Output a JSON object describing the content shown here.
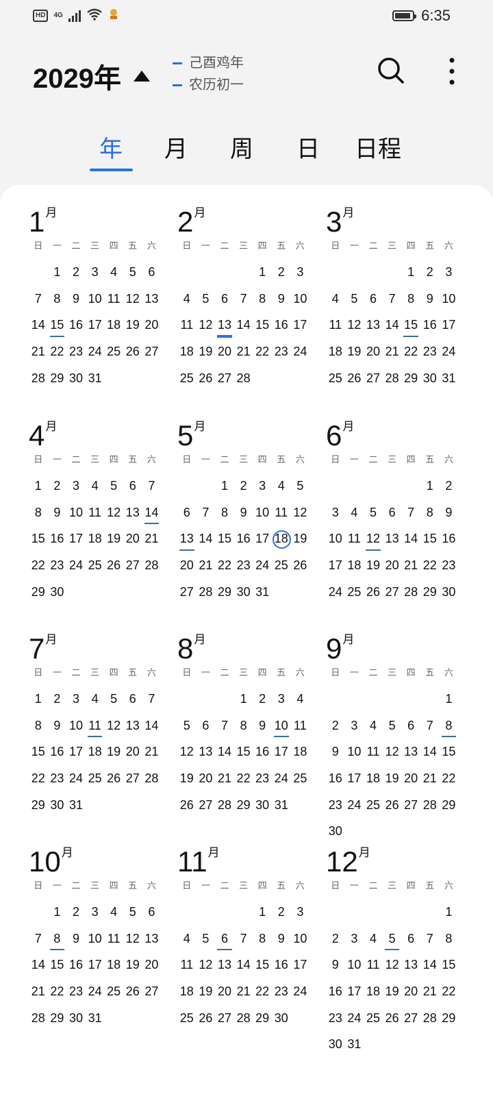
{
  "status_bar": {
    "hd_label": "HD",
    "network_label": "4G",
    "time": "6:35"
  },
  "header": {
    "year": "2029年",
    "lunar_line1": "己酉鸡年",
    "lunar_line2": "农历初一"
  },
  "tabs": [
    "年",
    "月",
    "周",
    "日",
    "日程"
  ],
  "active_tab": "年",
  "accent_color": "#2b6ee8",
  "month_suffix": "月",
  "weekdays": [
    "日",
    "一",
    "二",
    "三",
    "四",
    "五",
    "六"
  ],
  "today": {
    "month": 5,
    "day": 18
  },
  "months": [
    {
      "num": "1",
      "offset": 1,
      "days": 31,
      "marked": [
        15
      ]
    },
    {
      "num": "2",
      "offset": 4,
      "days": 28,
      "marked": [
        13
      ]
    },
    {
      "num": "3",
      "offset": 4,
      "days": 31,
      "marked": [
        15
      ]
    },
    {
      "num": "4",
      "offset": 0,
      "days": 30,
      "marked": [
        14
      ]
    },
    {
      "num": "5",
      "offset": 2,
      "days": 31,
      "marked": [
        13
      ]
    },
    {
      "num": "6",
      "offset": 5,
      "days": 30,
      "marked": [
        12
      ]
    },
    {
      "num": "7",
      "offset": 0,
      "days": 31,
      "marked": [
        11
      ]
    },
    {
      "num": "8",
      "offset": 3,
      "days": 31,
      "marked": [
        10
      ]
    },
    {
      "num": "9",
      "offset": 6,
      "days": 30,
      "marked": [
        8
      ]
    },
    {
      "num": "10",
      "offset": 1,
      "days": 31,
      "marked": [
        8
      ]
    },
    {
      "num": "11",
      "offset": 4,
      "days": 30,
      "marked": [
        6
      ]
    },
    {
      "num": "12",
      "offset": 6,
      "days": 31,
      "marked": [
        5
      ]
    }
  ]
}
